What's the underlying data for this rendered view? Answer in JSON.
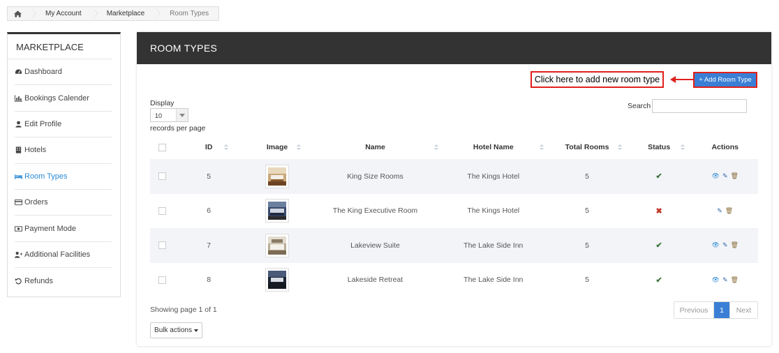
{
  "breadcrumb": {
    "home_icon": "home-icon",
    "items": [
      "My Account",
      "Marketplace",
      "Room Types"
    ]
  },
  "sidebar": {
    "title": "MARKETPLACE",
    "items": [
      {
        "label": "Dashboard",
        "icon": "dashboard-icon"
      },
      {
        "label": "Bookings Calender",
        "icon": "bar-chart-icon"
      },
      {
        "label": "Edit Profile",
        "icon": "user-icon"
      },
      {
        "label": "Hotels",
        "icon": "building-icon"
      },
      {
        "label": "Room Types",
        "icon": "bed-icon"
      },
      {
        "label": "Orders",
        "icon": "credit-card-icon"
      },
      {
        "label": "Payment Mode",
        "icon": "money-icon"
      },
      {
        "label": "Additional Facilities",
        "icon": "user-plus-icon"
      },
      {
        "label": "Refunds",
        "icon": "undo-icon"
      }
    ],
    "active_index": 4,
    "active_color": "#2a8ad6"
  },
  "panel": {
    "title": "ROOM TYPES",
    "callout": "Click here to add new room type",
    "add_button": "+ Add Room Type",
    "display_label": "Display",
    "page_length": "10",
    "records_label": "records per page",
    "search_label": "Search",
    "search_value": ""
  },
  "table": {
    "columns": [
      "ID",
      "Image",
      "Name",
      "Hotel Name",
      "Total Rooms",
      "Status",
      "Actions"
    ],
    "rows": [
      {
        "id": "5",
        "name": "King Size Rooms",
        "hotel": "The Kings Hotel",
        "rooms": "5",
        "status": "active",
        "actions": [
          "view",
          "edit",
          "delete"
        ]
      },
      {
        "id": "6",
        "name": "The King Executive Room",
        "hotel": "The Kings Hotel",
        "rooms": "5",
        "status": "inactive",
        "actions": [
          "edit",
          "delete"
        ]
      },
      {
        "id": "7",
        "name": "Lakeview Suite",
        "hotel": "The Lake Side Inn",
        "rooms": "5",
        "status": "active",
        "actions": [
          "view",
          "edit",
          "delete"
        ]
      },
      {
        "id": "8",
        "name": "Lakeside Retreat",
        "hotel": "The Lake Side Inn",
        "rooms": "5",
        "status": "active",
        "actions": [
          "view",
          "edit",
          "delete"
        ]
      }
    ]
  },
  "footer": {
    "info": "Showing page 1 of 1",
    "previous": "Previous",
    "page": "1",
    "next": "Next",
    "bulk_actions": "Bulk actions"
  },
  "colors": {
    "header_bg": "#333333",
    "accent": "#3a7fd5",
    "callout_border": "#e0201c"
  }
}
